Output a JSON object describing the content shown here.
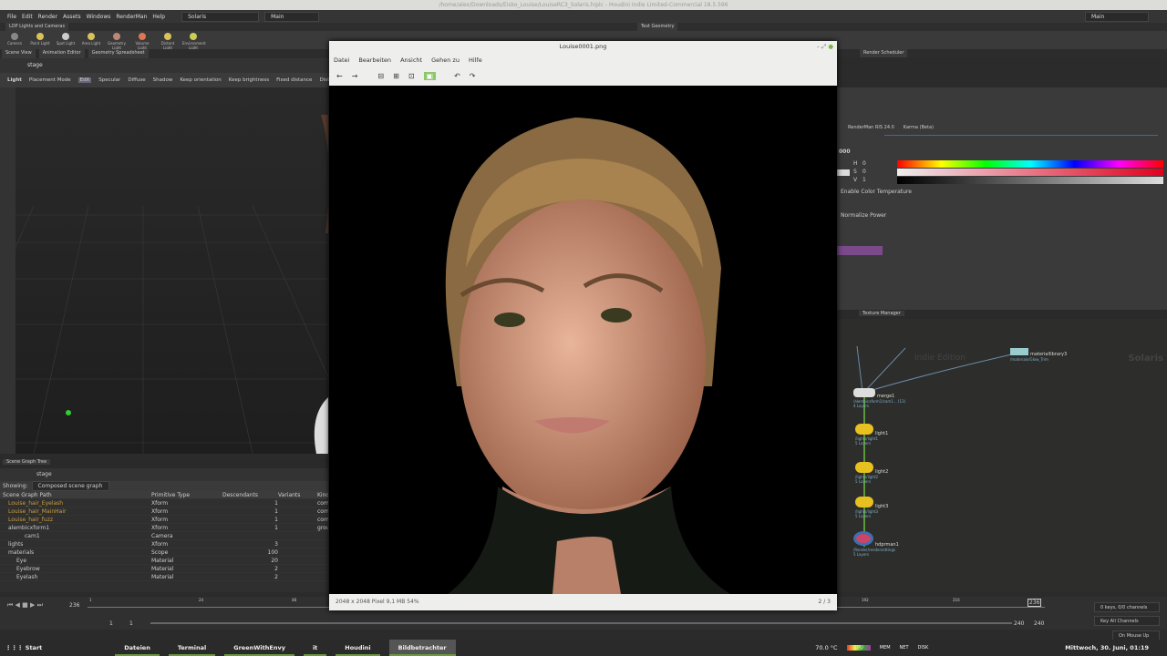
{
  "window_title": "/home/alex/Downloads/Eisko_Louise/LouiseRC3_Solaris.hiplc - Houdini Indie Limited-Commercial 18.5.596",
  "menu": [
    "File",
    "Edit",
    "Render",
    "Assets",
    "Windows",
    "RenderMan",
    "Help"
  ],
  "desktop": "Solaris",
  "desktop2": "Main",
  "desktop_right": "Main",
  "shelf_tab": "LOP Lights and Cameras",
  "shelf_tab2": "Test Geometry",
  "shelf_tools": [
    "Camera",
    "Point Light",
    "Spot Light",
    "Area Light",
    "Geometry Light",
    "Volume Light",
    "Distant Light",
    "Environment Light"
  ],
  "pane_tabs": [
    "Scene View",
    "Animation Editor",
    "Geometry Spreadsheet"
  ],
  "right_tabs": [
    "Render Scheduler"
  ],
  "path": "stage",
  "viewport_toolbar": {
    "light": "Light",
    "mode": "Placement Mode",
    "buttons": [
      "Edit",
      "Specular",
      "Diffuse",
      "Shadow"
    ],
    "options": [
      "Keep orientation",
      "Keep brightness",
      "Fixed distance",
      "Distance"
    ]
  },
  "scene_graph": {
    "tab": "Scene Graph Tree",
    "path": "stage",
    "showing_label": "Showing:",
    "showing": "Composed scene graph",
    "columns": [
      "Scene Graph Path",
      "Primitive Type",
      "Descendants",
      "Variants",
      "Kind"
    ],
    "rows": [
      {
        "name": "Louise_hair_Eyelash",
        "type": "Xform",
        "desc": "1",
        "kind": "com",
        "color": "#c8a040"
      },
      {
        "name": "Louise_hair_MainHair",
        "type": "Xform",
        "desc": "1",
        "kind": "com",
        "color": "#c8a040"
      },
      {
        "name": "Louise_hair_fuzz",
        "type": "Xform",
        "desc": "1",
        "kind": "com",
        "color": "#c8a040"
      },
      {
        "name": "alembicxform1",
        "type": "Xform",
        "desc": "1",
        "kind": "grou",
        "color": "#ccc"
      },
      {
        "name": "cam1",
        "type": "Camera",
        "desc": "",
        "kind": "",
        "color": "#ccc"
      },
      {
        "name": "lights",
        "type": "Xform",
        "desc": "3",
        "kind": "",
        "color": "#ccc"
      },
      {
        "name": "materials",
        "type": "Scope",
        "desc": "100",
        "kind": "",
        "color": "#ccc"
      },
      {
        "name": "Eye",
        "type": "Material",
        "desc": "20",
        "kind": "",
        "color": "#ccc"
      },
      {
        "name": "Eyebrow",
        "type": "Material",
        "desc": "2",
        "kind": "",
        "color": "#ccc"
      },
      {
        "name": "Eyelash",
        "type": "Material",
        "desc": "2",
        "kind": "",
        "color": "#ccc"
      }
    ]
  },
  "viewer": {
    "title": "Louise0001.png",
    "menu": [
      "Datei",
      "Bearbeiten",
      "Ansicht",
      "Gehen zu",
      "Hilfe"
    ],
    "status": "2048 x 2048 Pixel  9,1 MB   54%",
    "page": "2 / 3"
  },
  "params": {
    "tabs": [
      "RenderMan RIS 24.0",
      "Karma (Beta)"
    ],
    "value": "000",
    "h_label": "H",
    "h": "0",
    "s_label": "S",
    "s": "0",
    "v_label": "V",
    "v": "1",
    "enable_temp": "Enable Color Temperature",
    "normalize": "Normalize Power"
  },
  "network": {
    "tabs": [
      "Texture Manager"
    ],
    "watermark": "Indie Edition",
    "context": "Solaris",
    "nodes": [
      {
        "name": "materiallibrary3",
        "path": "/materials/Glow_Trim",
        "layers": ""
      },
      {
        "name": "merge1",
        "path": "/alembicxform1/cam1... (13)",
        "layers": "4 Layers"
      },
      {
        "name": "light1",
        "path": "/lights/light1",
        "layers": "5 Layers"
      },
      {
        "name": "light2",
        "path": "/lights/light2",
        "layers": "5 Layers"
      },
      {
        "name": "light3",
        "path": "/lights/light3",
        "layers": "5 Layers"
      },
      {
        "name": "hdprman1",
        "path": "/Render/rendersettings",
        "layers": "5 Layers"
      }
    ]
  },
  "timeline": {
    "frame": "236",
    "start": "1",
    "start2": "1",
    "end": "240",
    "end2": "240",
    "ticks": [
      "1",
      "24",
      "48",
      "192",
      "216"
    ],
    "keys": "0 keys, 0/0 channels",
    "key_all": "Key All Channels",
    "update": "On Mouse Up"
  },
  "taskbar": {
    "start": "Start",
    "apps": [
      "Dateien",
      "Terminal",
      "GreenWithEnvy",
      "it",
      "Houdini",
      "Bildbetrachter"
    ],
    "temp": "70.0 °C",
    "cpu": "CPU",
    "mem": "MEM",
    "net": "NET",
    "disk": "DISK",
    "clock": "Mittwoch, 30. Juni, 01:19"
  }
}
